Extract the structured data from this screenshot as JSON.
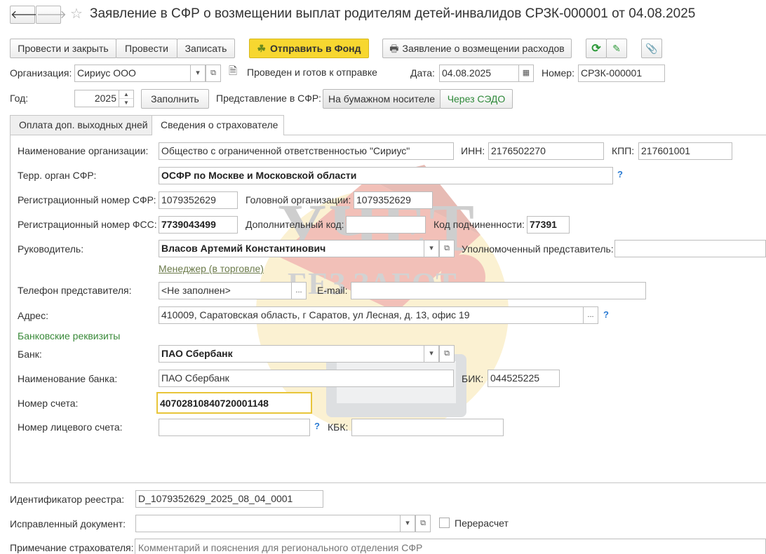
{
  "window": {
    "title": "Заявление в СФР о возмещении выплат родителям детей-инвалидов СРЗК-000001 от 04.08.2025"
  },
  "toolbar": {
    "post_close": "Провести и закрыть",
    "post": "Провести",
    "save": "Записать",
    "send_fund": "Отправить в Фонд",
    "reimbursement": "Заявление о возмещении расходов"
  },
  "header": {
    "org_label": "Организация:",
    "org_value": "Сириус ООО",
    "status": "Проведен и готов к отправке",
    "date_label": "Дата:",
    "date_value": "04.08.2025",
    "number_label": "Номер:",
    "number_value": "СРЗК-000001",
    "year_label": "Год:",
    "year_value": "2025",
    "fill_button": "Заполнить",
    "representation_label": "Представление в СФР:",
    "paper": "На бумажном носителе",
    "sedo": "Через СЭДО"
  },
  "tabs": [
    {
      "label": "Оплата доп. выходных дней"
    },
    {
      "label": "Сведения о страхователе"
    }
  ],
  "form": {
    "org_name_label": "Наименование организации:",
    "org_name_value": "Общество с ограниченной ответственностью \"Сириус\"",
    "inn_label": "ИНН:",
    "inn_value": "2176502270",
    "kpp_label": "КПП:",
    "kpp_value": "217601001",
    "terr_label": "Терр. орган СФР:",
    "terr_value": "ОСФР по Москве и Московской области",
    "reg_sfr_label": "Регистрационный номер СФР:",
    "reg_sfr_value": "1079352629",
    "head_org_label": "Головной организации:",
    "head_org_value": "1079352629",
    "reg_fss_label": "Регистрационный номер ФСС:",
    "reg_fss_value": "7739043499",
    "add_code_label": "Дополнительный код:",
    "add_code_value": "",
    "sub_code_label": "Код подчиненности:",
    "sub_code_value": "77391",
    "head_label": "Руководитель:",
    "head_value": "Власов Артемий Константинович",
    "authorized_label": "Уполномоченный представитель:",
    "authorized_value": "",
    "manager_link": "Менеджер (в торговле)",
    "phone_label": "Телефон представителя:",
    "phone_value": "<Не заполнен>",
    "email_label": "E-mail:",
    "email_value": "",
    "address_label": "Адрес:",
    "address_value": "410009, Саратовская область, г Саратов, ул Лесная, д. 13, офис 19",
    "bank_section": "Банковские реквизиты",
    "bank_label": "Банк:",
    "bank_value": "ПАО Сбербанк",
    "bank_name_label": "Наименование банка:",
    "bank_name_value": "ПАО Сбербанк",
    "bik_label": "БИК:",
    "bik_value": "044525225",
    "account_label": "Номер счета:",
    "account_value": "40702810840720001148",
    "personal_account_label": "Номер лицевого счета:",
    "personal_account_value": "",
    "kbk_label": "КБК:",
    "kbk_value": ""
  },
  "footer": {
    "registry_label": "Идентификатор реестра:",
    "registry_value": "D_1079352629_2025_08_04_0001",
    "corrected_label": "Исправленный документ:",
    "corrected_value": "",
    "recalc_label": "Перерасчет",
    "note_label": "Примечание страхователя:",
    "note_placeholder": "Комментарий и пояснения для регионального отделения СФР"
  },
  "colors": {
    "accent_yellow": "#f7d730",
    "link_green": "#3a8a3a",
    "help_blue": "#2a7bd3",
    "highlight_border": "#e8c53a"
  },
  "watermark": {
    "line1": "УЧЕТ",
    "line2": "БЕЗ ЗАБОТ"
  }
}
